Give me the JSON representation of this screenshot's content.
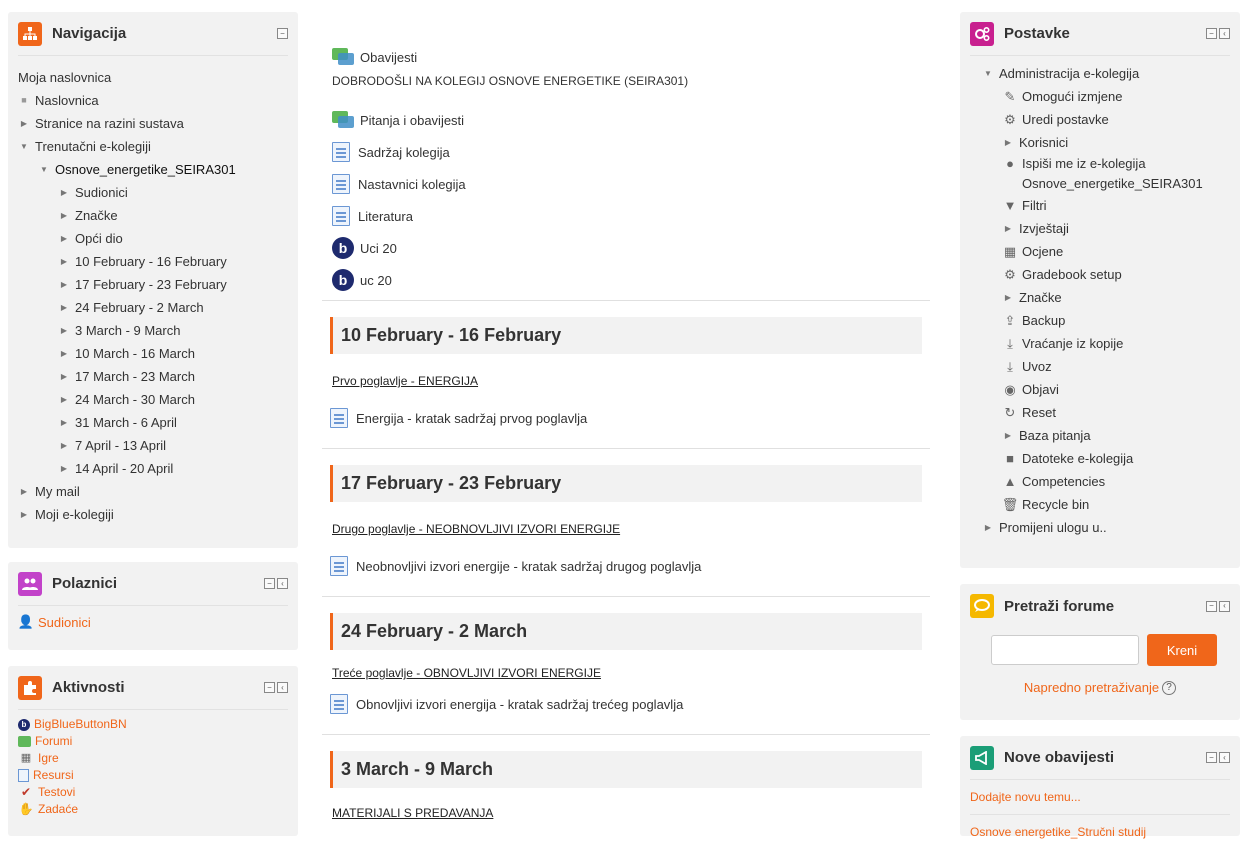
{
  "navigation": {
    "title": "Navigacija",
    "home": "Moja naslovnica",
    "items": [
      {
        "label": "Naslovnica"
      },
      {
        "label": "Stranice na razini sustava"
      },
      {
        "label": "Trenutačni e-kolegiji"
      },
      {
        "label": "Osnove_energetike_SEIRA301"
      },
      {
        "label": "Sudionici"
      },
      {
        "label": "Značke"
      },
      {
        "label": "Opći dio"
      },
      {
        "label": "10 February - 16 February"
      },
      {
        "label": "17 February - 23 February"
      },
      {
        "label": "24 February - 2 March"
      },
      {
        "label": "3 March - 9 March"
      },
      {
        "label": "10 March - 16 March"
      },
      {
        "label": "17 March - 23 March"
      },
      {
        "label": "24 March - 30 March"
      },
      {
        "label": "31 March - 6 April"
      },
      {
        "label": "7 April - 13 April"
      },
      {
        "label": "14 April - 20 April"
      },
      {
        "label": "My mail"
      },
      {
        "label": "Moji e-kolegiji"
      }
    ]
  },
  "participants": {
    "title": "Polaznici",
    "link": "Sudionici"
  },
  "activities": {
    "title": "Aktivnosti",
    "items": [
      "BigBlueButtonBN",
      "Forumi",
      "Igre",
      "Resursi",
      "Testovi",
      "Zadaće"
    ]
  },
  "main": {
    "general": {
      "news": "Obavijesti",
      "welcome": "DOBRODOŠLI NA KOLEGIJ OSNOVE ENERGETIKE (SEIRA301)",
      "items": [
        "Pitanja i obavijesti",
        "Sadržaj kolegija",
        "Nastavnici kolegija",
        "Literatura",
        "Uci 20",
        "uc 20"
      ]
    },
    "sections": [
      {
        "title": "10 February - 16 February",
        "label": "Prvo poglavlje - ENERGIJA",
        "resource": "Energija - kratak sadržaj prvog poglavlja"
      },
      {
        "title": "17 February - 23 February",
        "label": "Drugo poglavlje - NEOBNOVLJIVI IZVORI ENERGIJE",
        "resource": "Neobnovljivi izvori energije - kratak sadržaj drugog poglavlja"
      },
      {
        "title": "24 February - 2 March",
        "label": "Treće poglavlje - OBNOVLJIVI IZVORI ENERGIJE",
        "resource": "Obnovljivi izvori energija - kratak sadržaj trećeg poglavlja"
      },
      {
        "title": "3 March - 9 March",
        "label": "MATERIJALI S PREDAVANJA"
      }
    ]
  },
  "settings": {
    "title": "Postavke",
    "root": "Administracija e-kolegija",
    "items": [
      "Omogući izmjene",
      "Uredi postavke",
      "Korisnici",
      "Ispiši me iz e-kolegija",
      "Osnove_energetike_SEIRA301",
      "Filtri",
      "Izvještaji",
      "Ocjene",
      "Gradebook setup",
      "Značke",
      "Backup",
      "Vraćanje iz kopije",
      "Uvoz",
      "Objavi",
      "Reset",
      "Baza pitanja",
      "Datoteke e-kolegija",
      "Competencies",
      "Recycle bin"
    ],
    "switch_role": "Promijeni ulogu u.."
  },
  "forum_search": {
    "title": "Pretraži forume",
    "button": "Kreni",
    "advanced": "Napredno pretraživanje",
    "input_value": ""
  },
  "news": {
    "title": "Nove obavijesti",
    "add": "Dodajte novu temu...",
    "item": "Osnove energetike_Stručni studij"
  },
  "colors": {
    "accent": "#f0661a",
    "nav_icon": "#f0661a",
    "participants_icon": "#c242c9",
    "activities_icon": "#f0661a",
    "settings_icon": "#c8208f",
    "search_icon": "#f5b800",
    "news_icon": "#1b9e77"
  }
}
